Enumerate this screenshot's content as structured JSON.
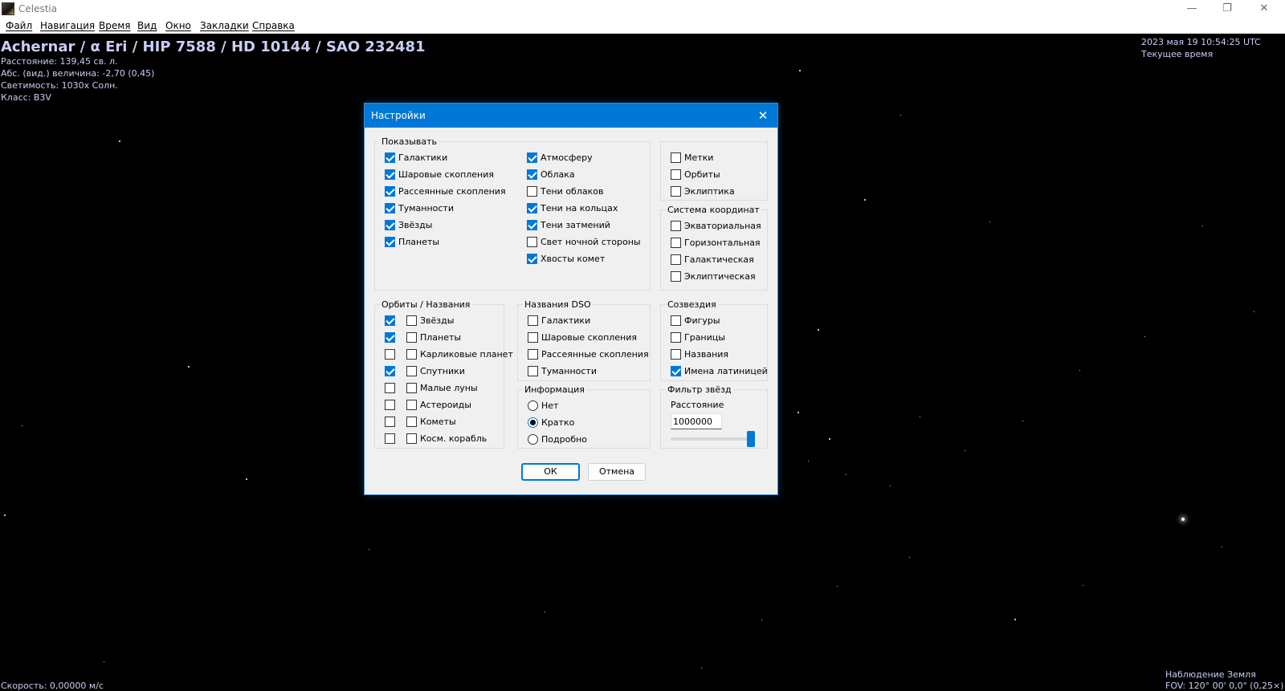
{
  "window": {
    "title": "Celestia",
    "minimize_glyph": "—",
    "restore_glyph": "❐",
    "close_glyph": "✕"
  },
  "menu": [
    "Файл",
    "Навигация",
    "Время",
    "Вид",
    "Окно",
    "Закладки",
    "Справка"
  ],
  "star_info": {
    "name": "Achernar / α Eri / HIP 7588 / HD 10144 / SAO 232481",
    "distance": "Расстояние: 139,45 св. л.",
    "magnitude": "Абс. (вид.) величина: -2,70 (0,45)",
    "luminosity": "Светимость: 1030x Солн.",
    "class": "Класс: B3V"
  },
  "time": {
    "datetime": "2023 мая 19 10:54:25 UTC",
    "mode": "Текущее время"
  },
  "status": {
    "speed": "Скорость: 0,00000 м/с",
    "observer": "Наблюдение Земля",
    "fov": "FOV: 120° 00' 0,0\" (0,25×)"
  },
  "dialog": {
    "title": "Настройки",
    "close_glyph": "✕",
    "show": {
      "label": "Показывать",
      "col1": [
        {
          "label": "Галактики",
          "checked": true
        },
        {
          "label": "Шаровые скопления",
          "checked": true
        },
        {
          "label": "Рассеянные скопления",
          "checked": true
        },
        {
          "label": "Туманности",
          "checked": true
        },
        {
          "label": "Звёзды",
          "checked": true
        },
        {
          "label": "Планеты",
          "checked": true
        }
      ],
      "col2": [
        {
          "label": "Атмосферу",
          "checked": true
        },
        {
          "label": "Облака",
          "checked": true
        },
        {
          "label": "Тени облаков",
          "checked": false
        },
        {
          "label": "Тени на кольцах",
          "checked": true
        },
        {
          "label": "Тени затмений",
          "checked": true
        },
        {
          "label": "Свет ночной стороны",
          "checked": false
        },
        {
          "label": "Хвосты комет",
          "checked": true
        }
      ]
    },
    "misc": [
      {
        "label": "Метки",
        "checked": false
      },
      {
        "label": "Орбиты",
        "checked": false
      },
      {
        "label": "Эклиптика",
        "checked": false
      }
    ],
    "coords": {
      "label": "Система координат",
      "items": [
        {
          "label": "Экваториальная",
          "checked": false
        },
        {
          "label": "Горизонтальная",
          "checked": false
        },
        {
          "label": "Галактическая",
          "checked": false
        },
        {
          "label": "Эклиптическая",
          "checked": false
        }
      ]
    },
    "orbits": {
      "label": "Орбиты / Названия",
      "items": [
        {
          "label": "Звёзды",
          "orbit": true,
          "name": false
        },
        {
          "label": "Планеты",
          "orbit": true,
          "name": false
        },
        {
          "label": "Карликовые планет",
          "orbit": false,
          "name": false
        },
        {
          "label": "Спутники",
          "orbit": true,
          "name": false
        },
        {
          "label": "Малые луны",
          "orbit": false,
          "name": false
        },
        {
          "label": "Астероиды",
          "orbit": false,
          "name": false
        },
        {
          "label": "Кометы",
          "orbit": false,
          "name": false
        },
        {
          "label": "Косм. корабль",
          "orbit": false,
          "name": false
        }
      ]
    },
    "dso": {
      "label": "Названия DSO",
      "items": [
        {
          "label": "Галактики",
          "checked": false
        },
        {
          "label": "Шаровые скопления",
          "checked": false
        },
        {
          "label": "Рассеянные скопления",
          "checked": false
        },
        {
          "label": "Туманности",
          "checked": false
        }
      ]
    },
    "constellations": {
      "label": "Созвездия",
      "items": [
        {
          "label": "Фигуры",
          "checked": false
        },
        {
          "label": "Границы",
          "checked": false
        },
        {
          "label": "Названия",
          "checked": false
        },
        {
          "label": "Имена латиницей",
          "checked": true
        }
      ]
    },
    "info": {
      "label": "Информация",
      "items": [
        {
          "label": "Нет",
          "selected": false
        },
        {
          "label": "Кратко",
          "selected": true
        },
        {
          "label": "Подробно",
          "selected": false
        }
      ]
    },
    "star_filter": {
      "label": "Фильтр звёзд",
      "distance_label": "Расстояние",
      "distance_value": "1000000",
      "slider_level": 1.0
    },
    "ok_label": "ОК",
    "cancel_label": "Отмена"
  }
}
